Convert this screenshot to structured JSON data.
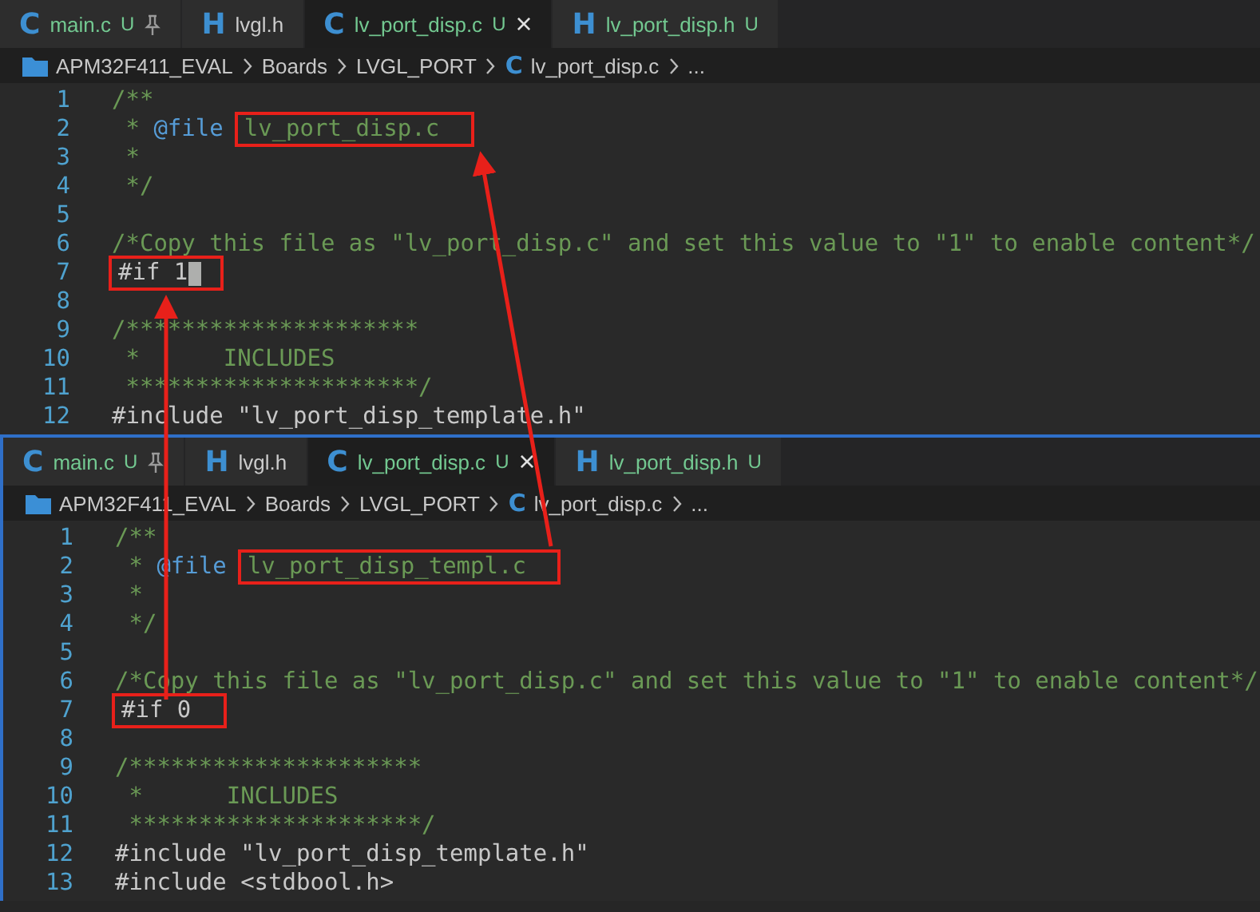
{
  "panes": [
    {
      "tabs": [
        {
          "icon": "C",
          "label": "main.c",
          "status": "U",
          "pinned": true,
          "selected": false
        },
        {
          "icon": "H",
          "label": "lvgl.h",
          "pinned": false,
          "selected": false
        },
        {
          "icon": "C",
          "label": "lv_port_disp.c",
          "status": "U",
          "pinned": false,
          "selected": true,
          "close": "×"
        },
        {
          "icon": "H",
          "label": "lv_port_disp.h",
          "status": "U",
          "pinned": false,
          "selected": false
        }
      ],
      "breadcrumb": [
        {
          "kind": "folder",
          "label": "APM32F411_EVAL"
        },
        {
          "kind": "plain",
          "label": "Boards"
        },
        {
          "kind": "plain",
          "label": "LVGL_PORT"
        },
        {
          "kind": "file",
          "icon": "C",
          "label": "lv_port_disp.c"
        },
        {
          "kind": "plain",
          "label": "..."
        }
      ],
      "lines": [
        {
          "number": "1",
          "tokens": [
            {
              "kind": "comment",
              "text": "/**"
            }
          ]
        },
        {
          "number": "2",
          "tokens": [
            {
              "kind": "comment",
              "text": " * "
            },
            {
              "kind": "tag",
              "text": "@file"
            },
            {
              "kind": "comment",
              "text": "lv_port_disp.c",
              "boxed": true
            }
          ]
        },
        {
          "number": "3",
          "tokens": [
            {
              "kind": "comment",
              "text": " *"
            }
          ]
        },
        {
          "number": "4",
          "tokens": [
            {
              "kind": "comment",
              "text": " */"
            }
          ]
        },
        {
          "number": "5"
        },
        {
          "number": "6",
          "tokens": [
            {
              "kind": "comment",
              "text": "/*Copy this file as \"lv_port_disp.c\" and set this value to \"1\" to enable content*/"
            }
          ]
        },
        {
          "number": "7",
          "tokens": [
            {
              "kind": "code",
              "text": "#if 1",
              "boxed": true,
              "cursor": true
            }
          ]
        },
        {
          "number": "8"
        },
        {
          "number": "9",
          "tokens": [
            {
              "kind": "comment",
              "text": "/*********************"
            }
          ]
        },
        {
          "number": "10",
          "tokens": [
            {
              "kind": "comment",
              "text": " *      INCLUDES"
            }
          ]
        },
        {
          "number": "11",
          "tokens": [
            {
              "kind": "comment",
              "text": " *********************/"
            }
          ]
        },
        {
          "number": "12",
          "tokens": [
            {
              "kind": "code",
              "text": "#include \"lv_port_disp_template.h\""
            }
          ]
        }
      ]
    },
    {
      "tabs": [
        {
          "icon": "C",
          "label": "main.c",
          "status": "U",
          "pinned": true,
          "selected": false
        },
        {
          "icon": "H",
          "label": "lvgl.h",
          "pinned": false,
          "selected": false
        },
        {
          "icon": "C",
          "label": "lv_port_disp.c",
          "status": "U",
          "pinned": false,
          "selected": true,
          "close": "×"
        },
        {
          "icon": "H",
          "label": "lv_port_disp.h",
          "status": "U",
          "pinned": false,
          "selected": false
        }
      ],
      "breadcrumb": [
        {
          "kind": "folder",
          "label": "APM32F411_EVAL"
        },
        {
          "kind": "plain",
          "label": "Boards"
        },
        {
          "kind": "plain",
          "label": "LVGL_PORT"
        },
        {
          "kind": "file",
          "icon": "C",
          "label": "lv_port_disp.c"
        },
        {
          "kind": "plain",
          "label": "..."
        }
      ],
      "lines": [
        {
          "number": "1",
          "tokens": [
            {
              "kind": "comment",
              "text": "/**"
            }
          ]
        },
        {
          "number": "2",
          "tokens": [
            {
              "kind": "comment",
              "text": " * "
            },
            {
              "kind": "tag",
              "text": "@file"
            },
            {
              "kind": "comment",
              "text": "lv_port_disp_templ.c",
              "boxed": true
            }
          ]
        },
        {
          "number": "3",
          "tokens": [
            {
              "kind": "comment",
              "text": " *"
            }
          ]
        },
        {
          "number": "4",
          "tokens": [
            {
              "kind": "comment",
              "text": " */"
            }
          ]
        },
        {
          "number": "5"
        },
        {
          "number": "6",
          "tokens": [
            {
              "kind": "comment",
              "text": "/*Copy this file as \"lv_port_disp.c\" and set this value to \"1\" to enable content*/"
            }
          ]
        },
        {
          "number": "7",
          "tokens": [
            {
              "kind": "code",
              "text": "#if 0",
              "boxed": true,
              "cursor": false
            }
          ]
        },
        {
          "number": "8"
        },
        {
          "number": "9",
          "tokens": [
            {
              "kind": "comment",
              "text": "/*********************"
            }
          ]
        },
        {
          "number": "10",
          "tokens": [
            {
              "kind": "comment",
              "text": " *      INCLUDES"
            }
          ]
        },
        {
          "number": "11",
          "tokens": [
            {
              "kind": "comment",
              "text": " *********************/"
            }
          ]
        },
        {
          "number": "12",
          "tokens": [
            {
              "kind": "code",
              "text": "#include \"lv_port_disp_template.h\""
            }
          ]
        },
        {
          "number": "13",
          "tokens": [
            {
              "kind": "code",
              "text": "#include <stdbool.h>"
            }
          ]
        }
      ]
    }
  ]
}
